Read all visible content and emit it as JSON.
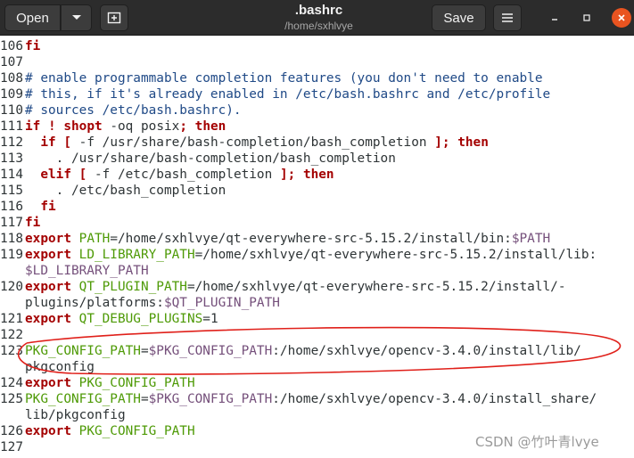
{
  "header": {
    "open_label": "Open",
    "title": ".bashrc",
    "subtitle": "/home/sxhlvye",
    "save_label": "Save",
    "icons": {
      "open_arrow": "chevron-down-icon",
      "new_tab": "new-tab-icon",
      "menu": "hamburger-menu-icon",
      "minimize": "minimize-icon",
      "maximize": "maximize-icon",
      "close": "close-icon"
    },
    "colors": {
      "close": "#e95420",
      "bar": "#2c2c2c"
    }
  },
  "editor": {
    "lines": [
      {
        "n": "106",
        "segs": [
          {
            "t": "fi",
            "c": "kw"
          }
        ]
      },
      {
        "n": "107",
        "segs": []
      },
      {
        "n": "108",
        "segs": [
          {
            "t": "# enable programmable completion features (you don't need to enable",
            "c": "cm"
          }
        ]
      },
      {
        "n": "109",
        "segs": [
          {
            "t": "# this, if it's already enabled in /etc/bash.bashrc and /etc/profile",
            "c": "cm"
          }
        ]
      },
      {
        "n": "110",
        "segs": [
          {
            "t": "# sources /etc/bash.bashrc).",
            "c": "cm"
          }
        ]
      },
      {
        "n": "111",
        "segs": [
          {
            "t": "if",
            "c": "kw"
          },
          {
            "t": " ",
            "c": ""
          },
          {
            "t": "!",
            "c": "kw"
          },
          {
            "t": " ",
            "c": ""
          },
          {
            "t": "shopt",
            "c": "kw"
          },
          {
            "t": " -oq posix",
            "c": ""
          },
          {
            "t": ";",
            "c": "kw"
          },
          {
            "t": " ",
            "c": ""
          },
          {
            "t": "then",
            "c": "kw"
          }
        ]
      },
      {
        "n": "112",
        "segs": [
          {
            "t": "  ",
            "c": ""
          },
          {
            "t": "if",
            "c": "kw"
          },
          {
            "t": " ",
            "c": ""
          },
          {
            "t": "[",
            "c": "kw"
          },
          {
            "t": " -f /usr/share/bash-completion/bash_completion ",
            "c": ""
          },
          {
            "t": "];",
            "c": "kw"
          },
          {
            "t": " ",
            "c": ""
          },
          {
            "t": "then",
            "c": "kw"
          }
        ]
      },
      {
        "n": "113",
        "segs": [
          {
            "t": "    . /usr/share/bash-completion/bash_completion",
            "c": ""
          }
        ]
      },
      {
        "n": "114",
        "segs": [
          {
            "t": "  ",
            "c": ""
          },
          {
            "t": "elif",
            "c": "kw"
          },
          {
            "t": " ",
            "c": ""
          },
          {
            "t": "[",
            "c": "kw"
          },
          {
            "t": " -f /etc/bash_completion ",
            "c": ""
          },
          {
            "t": "];",
            "c": "kw"
          },
          {
            "t": " ",
            "c": ""
          },
          {
            "t": "then",
            "c": "kw"
          }
        ]
      },
      {
        "n": "115",
        "segs": [
          {
            "t": "    . /etc/bash_completion",
            "c": ""
          }
        ]
      },
      {
        "n": "116",
        "segs": [
          {
            "t": "  ",
            "c": ""
          },
          {
            "t": "fi",
            "c": "kw"
          }
        ]
      },
      {
        "n": "117",
        "segs": [
          {
            "t": "fi",
            "c": "kw"
          }
        ]
      },
      {
        "n": "118",
        "segs": [
          {
            "t": "export",
            "c": "kw"
          },
          {
            "t": " ",
            "c": ""
          },
          {
            "t": "PATH",
            "c": "var"
          },
          {
            "t": "=/home/sxhlvye/qt-everywhere-src-5.15.2/install/bin:",
            "c": ""
          },
          {
            "t": "$PATH",
            "c": "str"
          }
        ]
      },
      {
        "n": "119",
        "segs": [
          {
            "t": "export",
            "c": "kw"
          },
          {
            "t": " ",
            "c": ""
          },
          {
            "t": "LD_LIBRARY_PATH",
            "c": "var"
          },
          {
            "t": "=/home/sxhlvye/qt-everywhere-src-5.15.2/install/lib:",
            "c": ""
          }
        ]
      },
      {
        "n": "",
        "segs": [
          {
            "t": "$LD_LIBRARY_PATH",
            "c": "str"
          }
        ]
      },
      {
        "n": "120",
        "segs": [
          {
            "t": "export",
            "c": "kw"
          },
          {
            "t": " ",
            "c": ""
          },
          {
            "t": "QT_PLUGIN_PATH",
            "c": "var"
          },
          {
            "t": "=/home/sxhlvye/qt-everywhere-src-5.15.2/install/-",
            "c": ""
          }
        ]
      },
      {
        "n": "",
        "segs": [
          {
            "t": "plugins/platforms:",
            "c": ""
          },
          {
            "t": "$QT_PLUGIN_PATH",
            "c": "str"
          }
        ]
      },
      {
        "n": "121",
        "segs": [
          {
            "t": "export",
            "c": "kw"
          },
          {
            "t": " ",
            "c": ""
          },
          {
            "t": "QT_DEBUG_PLUGINS",
            "c": "var"
          },
          {
            "t": "=1",
            "c": ""
          }
        ]
      },
      {
        "n": "122",
        "segs": []
      },
      {
        "n": "123",
        "segs": [
          {
            "t": "PKG_CONFIG_PATH",
            "c": "var"
          },
          {
            "t": "=",
            "c": ""
          },
          {
            "t": "$PKG_CONFIG_PATH",
            "c": "str"
          },
          {
            "t": ":/home/sxhlvye/opencv-3.4.0/install/lib/",
            "c": ""
          }
        ]
      },
      {
        "n": "",
        "segs": [
          {
            "t": "pkgconfig",
            "c": ""
          }
        ]
      },
      {
        "n": "124",
        "segs": [
          {
            "t": "export",
            "c": "kw"
          },
          {
            "t": " ",
            "c": ""
          },
          {
            "t": "PKG_CONFIG_PATH",
            "c": "var"
          }
        ]
      },
      {
        "n": "125",
        "segs": [
          {
            "t": "PKG_CONFIG_PATH",
            "c": "var"
          },
          {
            "t": "=",
            "c": ""
          },
          {
            "t": "$PKG_CONFIG_PATH",
            "c": "str"
          },
          {
            "t": ":/home/sxhlvye/opencv-3.4.0/install_share/",
            "c": ""
          }
        ]
      },
      {
        "n": "",
        "segs": [
          {
            "t": "lib/pkgconfig",
            "c": ""
          }
        ]
      },
      {
        "n": "126",
        "segs": [
          {
            "t": "export",
            "c": "kw"
          },
          {
            "t": " ",
            "c": ""
          },
          {
            "t": "PKG_CONFIG_PATH",
            "c": "var"
          }
        ]
      },
      {
        "n": "127",
        "segs": []
      }
    ],
    "colors": {
      "keyword": "#a40000",
      "comment": "#204a87",
      "variable": "#4e9a06",
      "expansion": "#75507b",
      "text": "#2e3436",
      "annotation": "#e0201a"
    }
  },
  "watermark": "CSDN @竹叶青lvye"
}
